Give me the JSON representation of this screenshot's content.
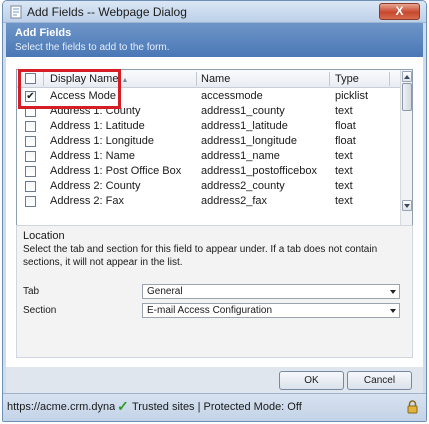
{
  "window": {
    "title": "Add Fields -- Webpage Dialog",
    "close_label": "X"
  },
  "header": {
    "title": "Add Fields",
    "subtitle": "Select the fields to add to the form."
  },
  "grid": {
    "columns": [
      "Display Name",
      "Name",
      "Type"
    ],
    "rows": [
      {
        "checked": true,
        "display_name": "Access Mode",
        "name": "accessmode",
        "type": "picklist"
      },
      {
        "checked": false,
        "display_name": "Address 1: County",
        "name": "address1_county",
        "type": "text"
      },
      {
        "checked": false,
        "display_name": "Address 1: Latitude",
        "name": "address1_latitude",
        "type": "float"
      },
      {
        "checked": false,
        "display_name": "Address 1: Longitude",
        "name": "address1_longitude",
        "type": "float"
      },
      {
        "checked": false,
        "display_name": "Address 1: Name",
        "name": "address1_name",
        "type": "text"
      },
      {
        "checked": false,
        "display_name": "Address 1: Post Office Box",
        "name": "address1_postofficebox",
        "type": "text"
      },
      {
        "checked": false,
        "display_name": "Address 2: County",
        "name": "address2_county",
        "type": "text"
      },
      {
        "checked": false,
        "display_name": "Address 2: Fax",
        "name": "address2_fax",
        "type": "text"
      }
    ]
  },
  "location": {
    "title": "Location",
    "description": "Select the tab and section for this field to appear under. If a tab does not contain sections, it will not appear in the list.",
    "tab_label": "Tab",
    "tab_value": "General",
    "section_label": "Section",
    "section_value": "E-mail Access Configuration"
  },
  "footer": {
    "ok_label": "OK",
    "cancel_label": "Cancel"
  },
  "statusbar": {
    "url": "https://acme.crm.dynamics",
    "status": "Trusted sites | Protected Mode: Off"
  },
  "colors": {
    "header": "#4a78b6",
    "highlight": "#d61c24",
    "trusted_check": "#2e9b2a"
  }
}
